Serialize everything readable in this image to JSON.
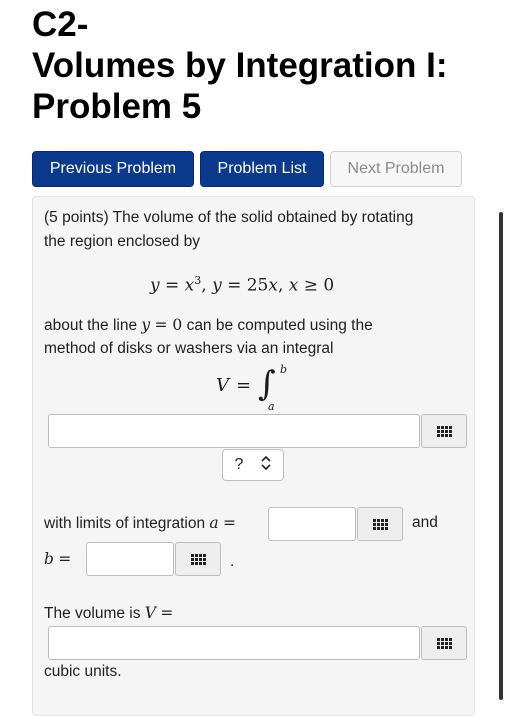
{
  "page": {
    "title_line1": "C2-",
    "title_line2": "Volumes by Integration I:",
    "title_line3": "Problem 5"
  },
  "nav": {
    "previous_label": "Previous Problem",
    "list_label": "Problem List",
    "next_label": "Next Problem"
  },
  "problem": {
    "intro_line1": "(5 points) The volume of the solid obtained by rotating",
    "intro_line2": "the region enclosed by",
    "about_text": "about the line",
    "can_be_computed": "can be computed using the",
    "method_line": "method of disks or washers via an integral",
    "with_limits_text": "with limits of integration",
    "and_text": "and",
    "period_text": ".",
    "volume_text": "The volume is",
    "units_text": "cubic units.",
    "select_value": "?",
    "integral_upper": "b",
    "integral_lower": "a"
  },
  "answers": {
    "integrand_value": "",
    "a_value": "",
    "b_value": "",
    "volume_value": ""
  },
  "icons": {
    "keyboard": "keyboard-icon",
    "chevron": "chevron-updown-icon"
  },
  "colors": {
    "primary_button": "#0b3a8c",
    "disabled_button": "#f7f7f7",
    "well_background": "#f5f5f5"
  }
}
